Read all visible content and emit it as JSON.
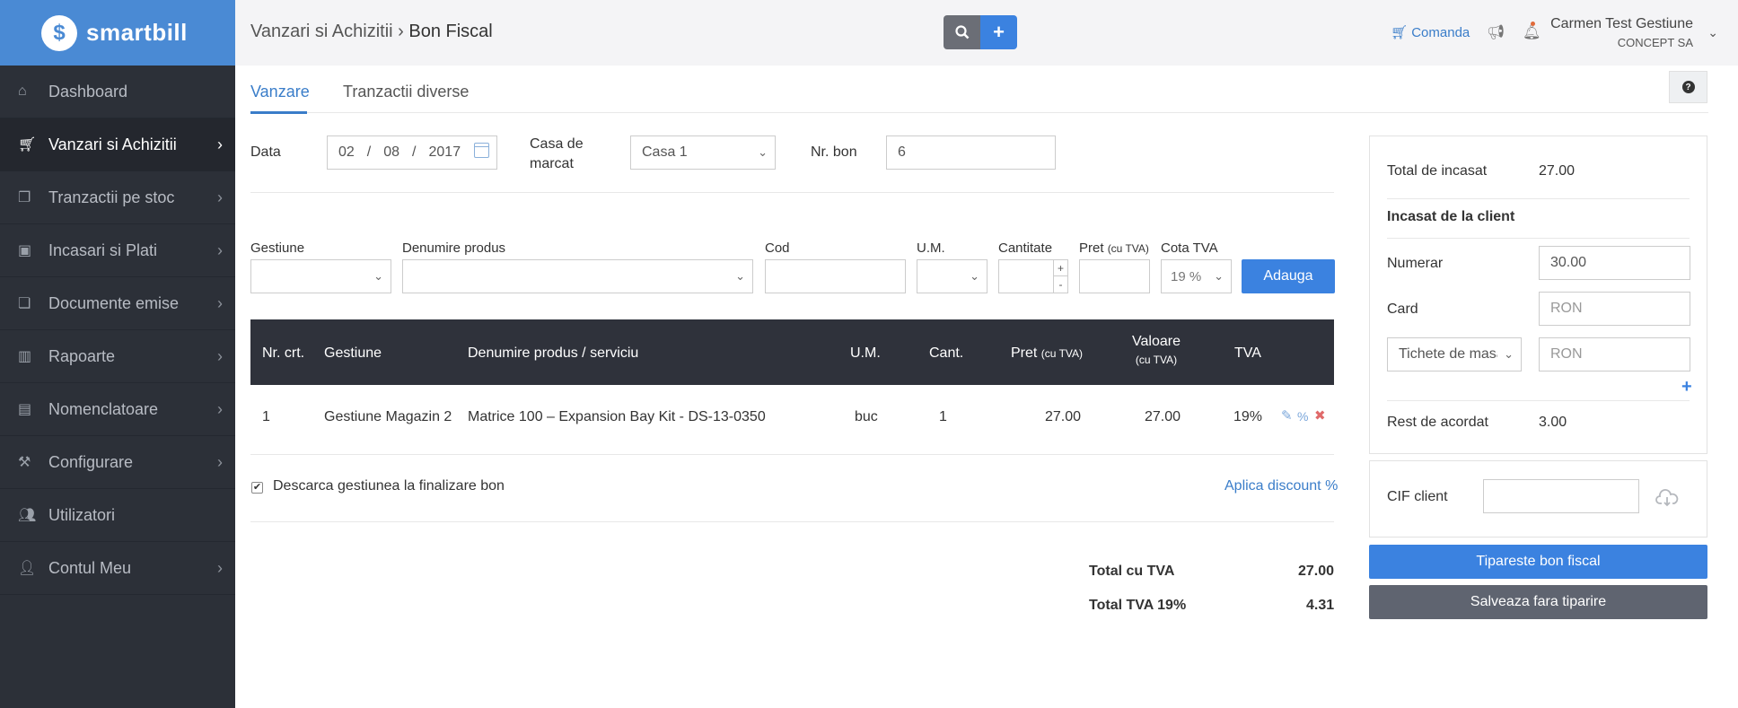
{
  "app": {
    "logo_text": "smartbill"
  },
  "sidebar": {
    "items": [
      {
        "label": "Dashboard",
        "icon": "home-icon"
      },
      {
        "label": "Vanzari si Achizitii",
        "icon": "cart-icon",
        "active": true
      },
      {
        "label": "Tranzactii pe stoc",
        "icon": "copy-icon"
      },
      {
        "label": "Incasari si Plati",
        "icon": "money-icon"
      },
      {
        "label": "Documente emise",
        "icon": "documents-icon"
      },
      {
        "label": "Rapoarte",
        "icon": "bar-chart-icon"
      },
      {
        "label": "Nomenclatoare",
        "icon": "list-icon"
      },
      {
        "label": "Configurare",
        "icon": "wrench-icon"
      },
      {
        "label": "Utilizatori",
        "icon": "users-icon"
      },
      {
        "label": "Contul Meu",
        "icon": "user-icon"
      }
    ]
  },
  "header": {
    "breadcrumb_parent": "Vanzari si Achizitii",
    "breadcrumb_sep": "›",
    "breadcrumb_current": "Bon Fiscal",
    "comanda_label": "Comanda",
    "user_name": "Carmen Test Gestiune",
    "user_company": "CONCEPT SA"
  },
  "tabs": [
    {
      "label": "Vanzare",
      "active": true
    },
    {
      "label": "Tranzactii diverse",
      "active": false
    }
  ],
  "form": {
    "data_label": "Data",
    "date_day": "02",
    "date_month": "08",
    "date_year": "2017",
    "date_sep": "/",
    "casa_label_line1": "Casa de",
    "casa_label_line2": "marcat",
    "casa_value": "Casa 1",
    "nr_bon_label": "Nr. bon",
    "nr_bon_value": "6"
  },
  "product_form": {
    "gestiune_label": "Gestiune",
    "denumire_label": "Denumire produs",
    "cod_label": "Cod",
    "um_label": "U.M.",
    "cantitate_label": "Cantitate",
    "pret_label": "Pret",
    "pret_sub": "(cu TVA)",
    "cota_label": "Cota TVA",
    "cota_value": "19 %",
    "stepper_plus": "+",
    "stepper_minus": "-",
    "add_button": "Adauga"
  },
  "table": {
    "headers": {
      "nr": "Nr. crt.",
      "gestiune": "Gestiune",
      "denumire": "Denumire produs / serviciu",
      "um": "U.M.",
      "cant": "Cant.",
      "pret": "Pret",
      "pret_sub": "(cu TVA)",
      "valoare": "Valoare",
      "valoare_sub": "(cu TVA)",
      "tva": "TVA"
    },
    "rows": [
      {
        "nr": "1",
        "gestiune": "Gestiune Magazin 2",
        "denumire": "Matrice 100 – Expansion Bay Kit - DS-13-0350",
        "um": "buc",
        "cant": "1",
        "pret": "27.00",
        "valoare": "27.00",
        "tva": "19%"
      }
    ]
  },
  "options": {
    "descarca_label": "Descarca gestiunea la finalizare bon",
    "descarca_checked": true,
    "discount_link": "Aplica discount %"
  },
  "totals": {
    "total_cu_tva_label": "Total cu TVA",
    "total_cu_tva_value": "27.00",
    "total_tva_label": "Total TVA 19%",
    "total_tva_value": "4.31"
  },
  "payment": {
    "total_incasat_label": "Total de incasat",
    "total_incasat_value": "27.00",
    "incasat_client_label": "Incasat de la client",
    "numerar_label": "Numerar",
    "numerar_value": "30.00",
    "card_label": "Card",
    "card_placeholder": "RON",
    "tichete_label": "Tichete de masa",
    "tichete_placeholder": "RON",
    "rest_label": "Rest de acordat",
    "rest_value": "3.00",
    "cif_label": "CIF client",
    "print_button": "Tipareste bon fiscal",
    "save_button": "Salveaza fara tiparire"
  }
}
